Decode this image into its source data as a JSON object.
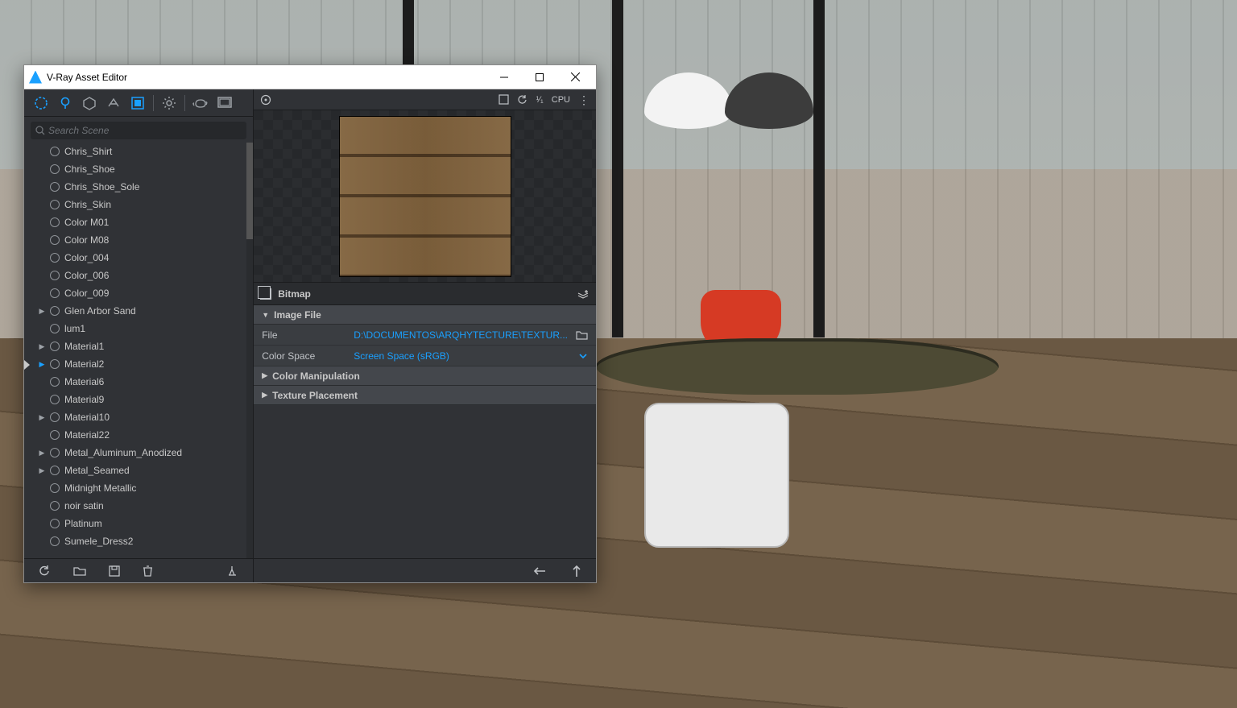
{
  "window": {
    "title": "V-Ray Asset Editor"
  },
  "search": {
    "placeholder": "Search Scene"
  },
  "materials": [
    {
      "name": "Chris_Shirt",
      "expandable": false
    },
    {
      "name": "Chris_Shoe",
      "expandable": false
    },
    {
      "name": "Chris_Shoe_Sole",
      "expandable": false
    },
    {
      "name": "Chris_Skin",
      "expandable": false
    },
    {
      "name": "Color M01",
      "expandable": false
    },
    {
      "name": "Color M08",
      "expandable": false
    },
    {
      "name": "Color_004",
      "expandable": false
    },
    {
      "name": "Color_006",
      "expandable": false
    },
    {
      "name": "Color_009",
      "expandable": false
    },
    {
      "name": "Glen Arbor Sand",
      "expandable": true
    },
    {
      "name": "lum1",
      "expandable": false
    },
    {
      "name": "Material1",
      "expandable": true
    },
    {
      "name": "Material2",
      "expandable": true,
      "active": true
    },
    {
      "name": "Material6",
      "expandable": false
    },
    {
      "name": "Material9",
      "expandable": false
    },
    {
      "name": "Material10",
      "expandable": true
    },
    {
      "name": "Material22",
      "expandable": false
    },
    {
      "name": "Metal_Aluminum_Anodized",
      "expandable": true
    },
    {
      "name": "Metal_Seamed",
      "expandable": true
    },
    {
      "name": "Midnight Metallic",
      "expandable": false
    },
    {
      "name": "noir satin",
      "expandable": false
    },
    {
      "name": "Platinum",
      "expandable": false
    },
    {
      "name": "Sumele_Dress2",
      "expandable": false
    }
  ],
  "preview": {
    "ratio": "¹⁄₁",
    "engine": "CPU"
  },
  "panel": {
    "type": "Bitmap",
    "section_image": "Image File",
    "file_label": "File",
    "file_value": "D:\\DOCUMENTOS\\ARQHYTECTURE\\TEXTUR...",
    "colorspace_label": "Color Space",
    "colorspace_value": "Screen Space (sRGB)",
    "section_colormanip": "Color Manipulation",
    "section_texplace": "Texture Placement"
  }
}
